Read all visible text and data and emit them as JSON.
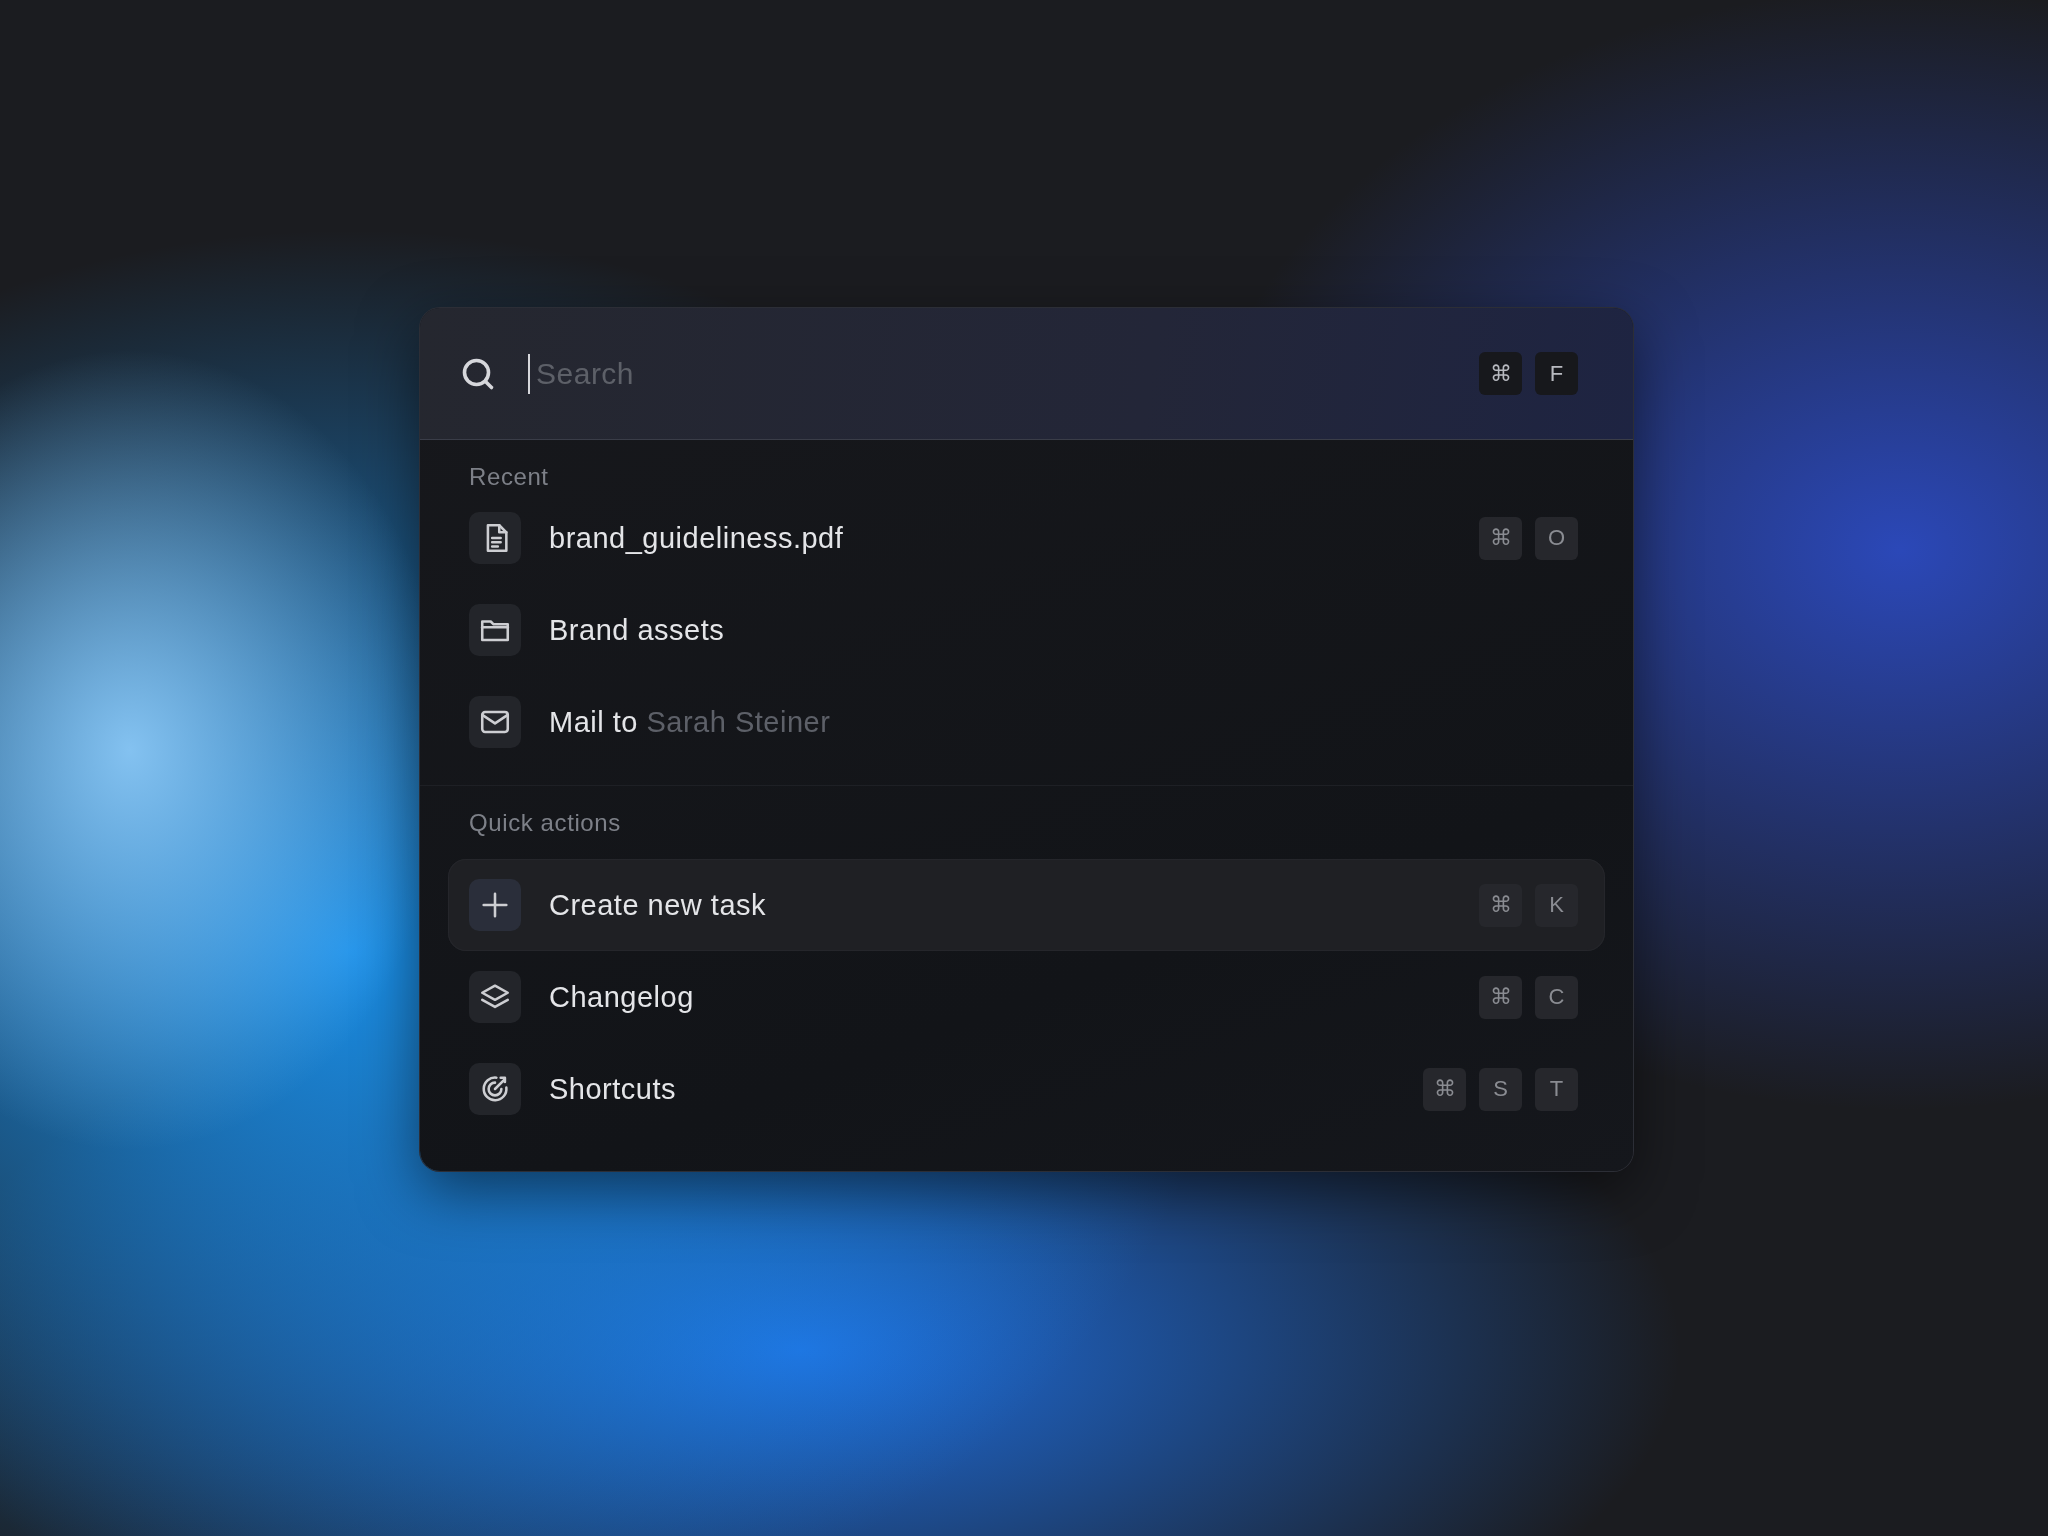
{
  "search": {
    "placeholder": "Search",
    "keys": [
      "⌘",
      "F"
    ]
  },
  "sections": [
    {
      "title": "Recent",
      "items": [
        {
          "kind": "file",
          "label": "brand_guideliness.pdf",
          "keys": [
            "⌘",
            "O"
          ],
          "selected": false
        },
        {
          "kind": "folder",
          "label": "Brand assets",
          "selected": false
        },
        {
          "kind": "mail",
          "label": "Mail to",
          "detail": "Sarah Steiner",
          "selected": false
        }
      ]
    },
    {
      "title": "Quick actions",
      "items": [
        {
          "kind": "plus",
          "label": "Create new task",
          "keys": [
            "⌘",
            "K"
          ],
          "selected": true
        },
        {
          "kind": "layers",
          "label": "Changelog",
          "keys": [
            "⌘",
            "C"
          ],
          "selected": false
        },
        {
          "kind": "target",
          "label": "Shortcuts",
          "keys": [
            "⌘",
            "S",
            "T"
          ],
          "selected": false
        }
      ]
    }
  ]
}
